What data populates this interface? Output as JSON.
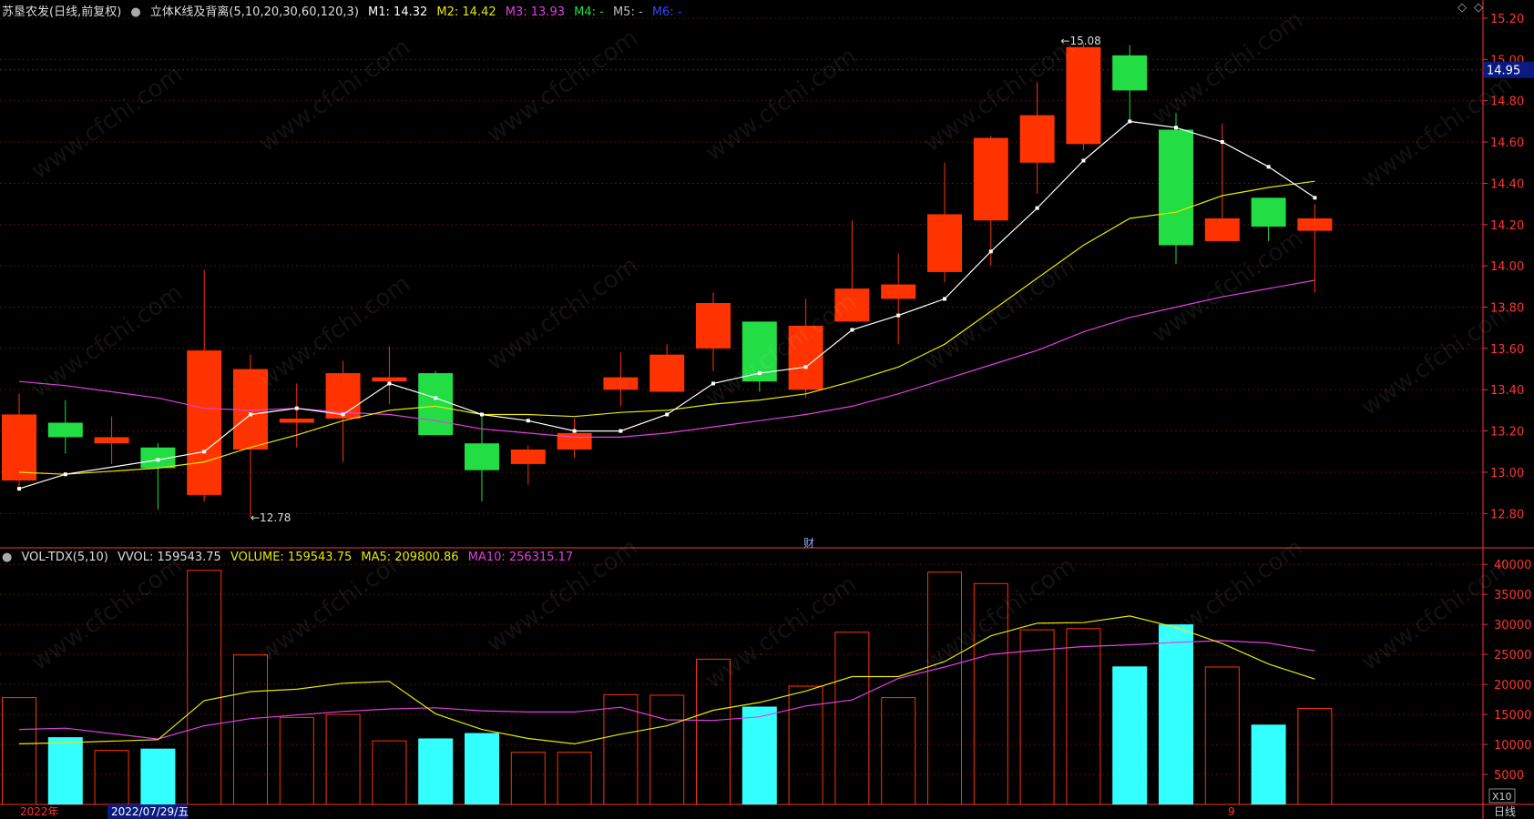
{
  "header": {
    "stock_name": "苏垦农发(日线,前复权)",
    "indicator_name": "立体K线及背离(5,10,20,30,60,120,3)",
    "m1": "M1: 14.32",
    "m2": "M2: 14.42",
    "m3": "M3: 13.93",
    "m4": "M4: -",
    "m5": "M5: -",
    "m6": "M6: -"
  },
  "volume_header": {
    "name": "VOL-TDX(5,10)",
    "vvol": "VVOL: 159543.75",
    "volume": "VOLUME: 159543.75",
    "ma5": "MA5: 209800.86",
    "ma10": "MA10: 256315.17"
  },
  "current_price": "14.95",
  "high_label": "15.08",
  "low_label": "12.78",
  "event_marker": "财",
  "bottom_labels": {
    "year": "2022年",
    "cursor_date": "2022/07/29/五",
    "month": "9",
    "period": "日线",
    "x10": "X10"
  },
  "watermark": "www.cfchi.com",
  "colors": {
    "up": "#ff3300",
    "down": "#22dd44",
    "vol_down": "#33ffff",
    "ma_white": "#ffffff",
    "ma_yellow": "#e8e800",
    "ma_magenta": "#e040e0",
    "axis": "#ff3333"
  },
  "chart_data": [
    {
      "type": "candlestick",
      "ylim": [
        12.7,
        15.2
      ],
      "y_ticks": [
        "15.20",
        "15.00",
        "14.80",
        "14.60",
        "14.40",
        "14.20",
        "14.00",
        "13.80",
        "13.60",
        "13.40",
        "13.20",
        "13.00",
        "12.80"
      ],
      "candles": [
        {
          "o": 12.96,
          "c": 13.28,
          "h": 13.38,
          "l": 12.91,
          "up": true
        },
        {
          "o": 13.24,
          "c": 13.17,
          "h": 13.35,
          "l": 13.09,
          "up": false
        },
        {
          "o": 13.14,
          "c": 13.17,
          "h": 13.27,
          "l": 13.04,
          "up": true
        },
        {
          "o": 13.12,
          "c": 13.02,
          "h": 13.14,
          "l": 12.82,
          "up": false
        },
        {
          "o": 12.89,
          "c": 13.59,
          "h": 13.98,
          "l": 12.86,
          "up": true
        },
        {
          "o": 13.11,
          "c": 13.5,
          "h": 13.57,
          "l": 12.78,
          "up": true
        },
        {
          "o": 13.24,
          "c": 13.26,
          "h": 13.43,
          "l": 13.12,
          "up": true
        },
        {
          "o": 13.26,
          "c": 13.48,
          "h": 13.54,
          "l": 13.05,
          "up": true
        },
        {
          "o": 13.44,
          "c": 13.46,
          "h": 13.61,
          "l": 13.33,
          "up": true
        },
        {
          "o": 13.48,
          "c": 13.18,
          "h": 13.49,
          "l": 13.18,
          "up": false
        },
        {
          "o": 13.14,
          "c": 13.01,
          "h": 13.28,
          "l": 12.86,
          "up": false
        },
        {
          "o": 13.04,
          "c": 13.11,
          "h": 13.13,
          "l": 12.94,
          "up": true
        },
        {
          "o": 13.11,
          "c": 13.19,
          "h": 13.26,
          "l": 13.07,
          "up": true
        },
        {
          "o": 13.4,
          "c": 13.46,
          "h": 13.58,
          "l": 13.32,
          "up": true
        },
        {
          "o": 13.39,
          "c": 13.57,
          "h": 13.62,
          "l": 13.39,
          "up": true
        },
        {
          "o": 13.6,
          "c": 13.82,
          "h": 13.87,
          "l": 13.49,
          "up": true
        },
        {
          "o": 13.73,
          "c": 13.44,
          "h": 13.73,
          "l": 13.39,
          "up": false
        },
        {
          "o": 13.4,
          "c": 13.71,
          "h": 13.84,
          "l": 13.36,
          "up": true
        },
        {
          "o": 13.73,
          "c": 13.89,
          "h": 14.22,
          "l": 13.74,
          "up": true
        },
        {
          "o": 13.84,
          "c": 13.91,
          "h": 14.06,
          "l": 13.62,
          "up": true
        },
        {
          "o": 13.97,
          "c": 14.25,
          "h": 14.5,
          "l": 13.92,
          "up": true
        },
        {
          "o": 14.22,
          "c": 14.62,
          "h": 14.63,
          "l": 14.0,
          "up": true
        },
        {
          "o": 14.5,
          "c": 14.73,
          "h": 14.89,
          "l": 14.35,
          "up": true
        },
        {
          "o": 14.59,
          "c": 15.06,
          "h": 15.08,
          "l": 14.56,
          "up": true
        },
        {
          "o": 15.02,
          "c": 14.85,
          "h": 15.07,
          "l": 14.7,
          "up": false
        },
        {
          "o": 14.66,
          "c": 14.1,
          "h": 14.74,
          "l": 14.01,
          "up": false
        },
        {
          "o": 14.12,
          "c": 14.23,
          "h": 14.69,
          "l": 14.12,
          "up": true
        },
        {
          "o": 14.33,
          "c": 14.19,
          "h": 14.33,
          "l": 14.12,
          "up": false
        },
        {
          "o": 14.17,
          "c": 14.23,
          "h": 14.3,
          "l": 13.87,
          "up": true
        }
      ],
      "ma_white": [
        12.92,
        12.99,
        null,
        13.06,
        13.1,
        13.28,
        13.31,
        13.28,
        13.43,
        13.36,
        13.28,
        13.25,
        13.2,
        13.2,
        13.28,
        13.43,
        13.48,
        13.51,
        13.69,
        13.76,
        13.84,
        14.07,
        14.28,
        14.51,
        14.7,
        14.67,
        14.6,
        14.48,
        14.33
      ],
      "ma_yellow": [
        13.0,
        12.99,
        null,
        13.02,
        13.05,
        13.12,
        13.18,
        13.25,
        13.3,
        13.32,
        13.28,
        13.28,
        13.27,
        13.29,
        13.3,
        13.33,
        13.35,
        13.38,
        13.44,
        13.51,
        13.62,
        13.78,
        13.94,
        14.1,
        14.23,
        14.26,
        14.34,
        14.38,
        14.41
      ],
      "ma_magenta": [
        13.44,
        13.42,
        null,
        13.36,
        13.31,
        13.3,
        13.31,
        13.29,
        13.28,
        13.25,
        13.21,
        13.19,
        13.17,
        13.17,
        13.19,
        13.22,
        13.25,
        13.28,
        13.32,
        13.38,
        13.45,
        13.52,
        13.59,
        13.68,
        13.75,
        13.8,
        13.85,
        13.89,
        13.93
      ]
    },
    {
      "type": "bar",
      "ylim": [
        0,
        42000
      ],
      "y_ticks": [
        "40000",
        "35000",
        "30000",
        "25000",
        "20000",
        "15000",
        "10000",
        "5000"
      ],
      "volumes": [
        17800,
        11200,
        9000,
        9300,
        39000,
        24900,
        14500,
        15000,
        10600,
        11000,
        11900,
        8700,
        8700,
        18300,
        18200,
        24200,
        16300,
        19700,
        28700,
        17800,
        38700,
        36800,
        29100,
        29300,
        23000,
        30000,
        22900,
        13300,
        16000
      ],
      "vol_ma5": [
        10100,
        10300,
        null,
        10800,
        17300,
        18800,
        19200,
        20200,
        20500,
        15100,
        12500,
        11000,
        10100,
        11700,
        13100,
        15700,
        17000,
        18900,
        21300,
        21300,
        23800,
        28100,
        30200,
        30300,
        31400,
        29500,
        26800,
        23400,
        20900
      ],
      "vol_ma10": [
        12500,
        12700,
        null,
        10900,
        13100,
        14300,
        14900,
        15500,
        15900,
        16100,
        15600,
        15400,
        15400,
        16200,
        14100,
        14000,
        14600,
        16400,
        17400,
        21000,
        22900,
        25000,
        25700,
        26300,
        26600,
        27000,
        27300,
        26900,
        25600
      ]
    }
  ]
}
